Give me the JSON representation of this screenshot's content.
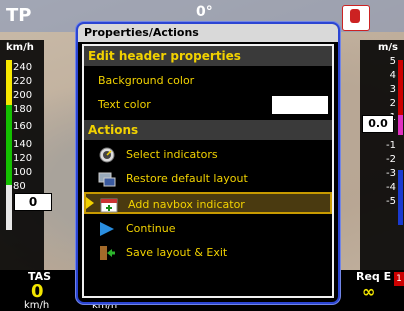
{
  "header": {
    "brand": "TP",
    "heading": "0°"
  },
  "left_gauge": {
    "unit": "km/h",
    "ticks": [
      "240",
      "220",
      "200",
      "180",
      "160",
      "140",
      "120",
      "100",
      "80"
    ],
    "speed_value": "0"
  },
  "right_gauge": {
    "unit": "m/s",
    "ticks": [
      "5",
      "4",
      "3",
      "2",
      "1",
      "-1",
      "-2",
      "-3",
      "-4",
      "-5"
    ],
    "vario_value": "0.0"
  },
  "bottom": {
    "tas_label": "TAS",
    "tas_value": "0",
    "tas_unit": "km/h",
    "tas_unit2": "km/h",
    "req_label": "Req E",
    "req_value": "∞",
    "req_badge": "1"
  },
  "dialog": {
    "title": "Properties/Actions",
    "section_header": "Edit header properties",
    "background_color_label": "Background color",
    "text_color_label": "Text color",
    "actions_header": "Actions",
    "actions": [
      {
        "label": "Select indicators",
        "icon": "gauge-icon"
      },
      {
        "label": "Restore default layout",
        "icon": "restore-layout-icon"
      },
      {
        "label": "Add navbox indicator",
        "icon": "calendar-add-icon"
      },
      {
        "label": "Continue",
        "icon": "play-icon"
      },
      {
        "label": "Save layout & Exit",
        "icon": "exit-icon"
      }
    ]
  },
  "colors": {
    "accent": "#f2d200",
    "dialog_border": "#2b45d3",
    "selected_row_border": "#c89a00"
  }
}
